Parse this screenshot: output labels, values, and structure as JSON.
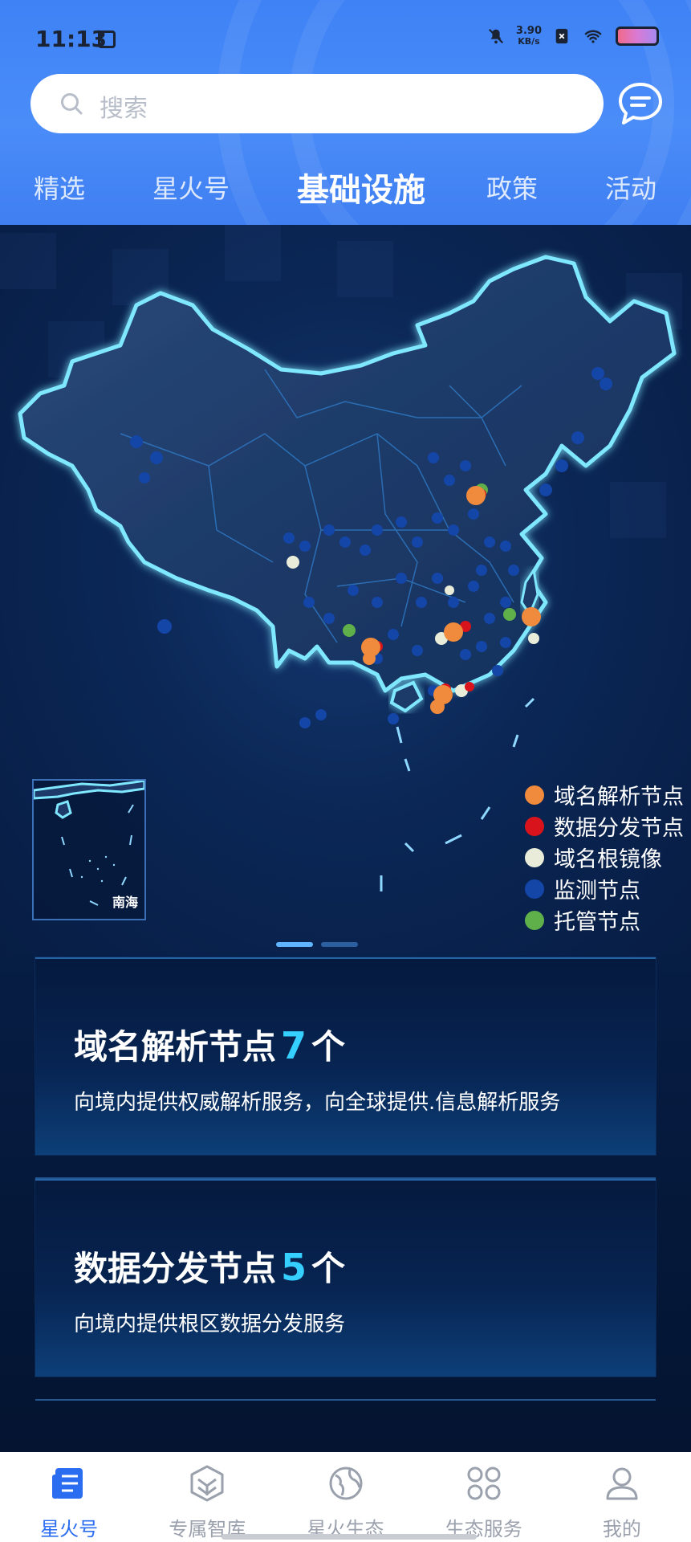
{
  "status_bar": {
    "time": "11:13",
    "net_speed_value": "3.90",
    "net_speed_unit": "KB/s"
  },
  "search": {
    "placeholder": "搜索"
  },
  "tabs": [
    {
      "label": "精选",
      "active": false
    },
    {
      "label": "星火号",
      "active": false
    },
    {
      "label": "基础设施",
      "active": true
    },
    {
      "label": "政策",
      "active": false
    },
    {
      "label": "活动",
      "active": false
    }
  ],
  "map": {
    "inset_label": "南海",
    "legend": [
      {
        "label": "域名解析节点",
        "color": "#f08a3c"
      },
      {
        "label": "数据分发节点",
        "color": "#d8131b"
      },
      {
        "label": "域名根镜像",
        "color": "#e8ecd8"
      },
      {
        "label": "监测节点",
        "color": "#1446a8"
      },
      {
        "label": "托管节点",
        "color": "#5fb04a"
      }
    ]
  },
  "cards": [
    {
      "title": "域名解析节点",
      "count": "7",
      "unit": "个",
      "desc": "向境内提供权威解析服务，向全球提供.信息解析服务"
    },
    {
      "title": "数据分发节点",
      "count": "5",
      "unit": "个",
      "desc": "向境内提供根区数据分发服务"
    }
  ],
  "bottom_nav": [
    {
      "label": "星火号",
      "active": true,
      "icon": "news-icon"
    },
    {
      "label": "专属智库",
      "active": false,
      "icon": "think-tank-icon"
    },
    {
      "label": "星火生态",
      "active": false,
      "icon": "globe-icon"
    },
    {
      "label": "生态服务",
      "active": false,
      "icon": "grid-icon"
    },
    {
      "label": "我的",
      "active": false,
      "icon": "user-icon"
    }
  ],
  "colors": {
    "accent": "#2b6df0",
    "header_blue": "#4a8cf8",
    "count_cyan": "#35d0ff"
  }
}
